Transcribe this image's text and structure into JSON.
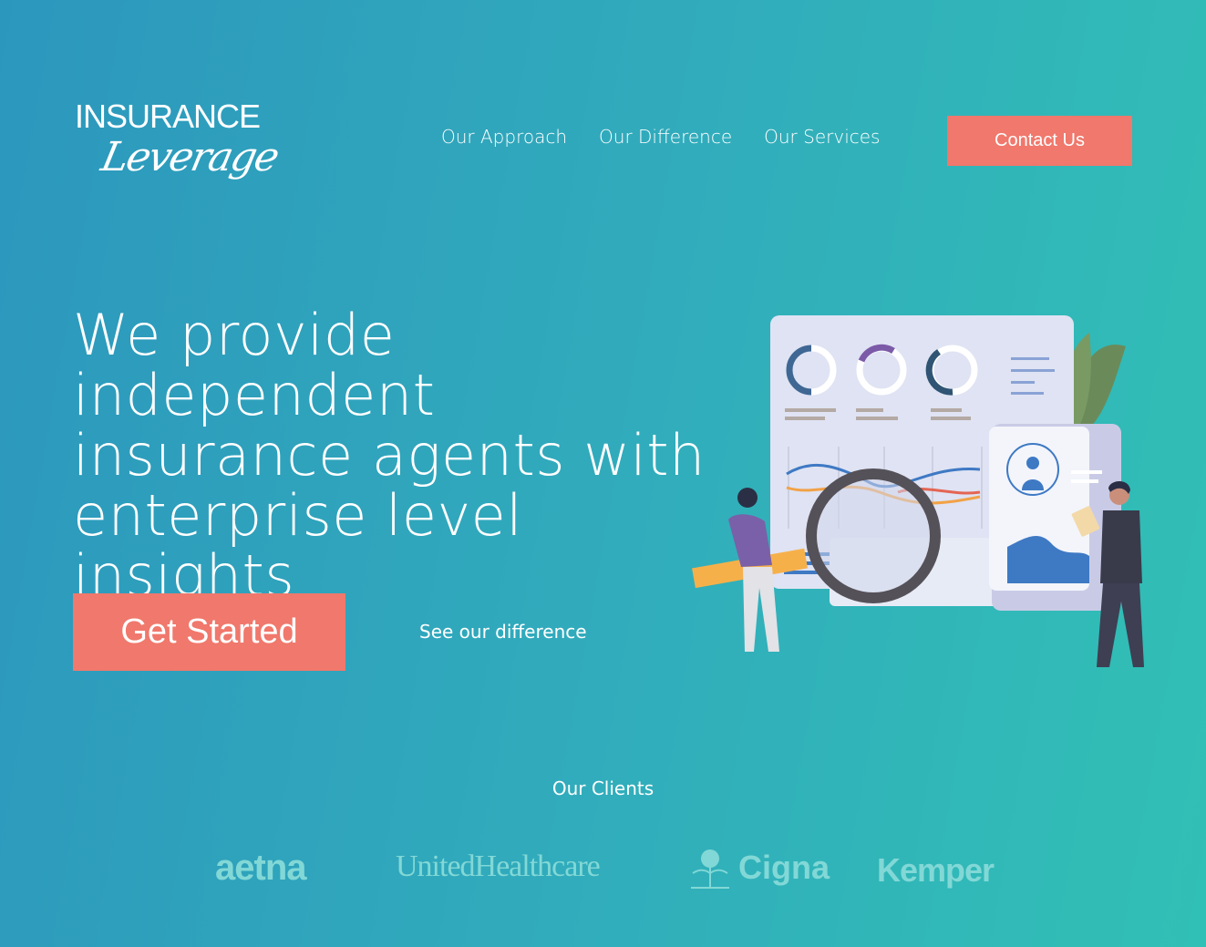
{
  "brand": {
    "name_top": "INSURANCE",
    "name_script": "Leverage"
  },
  "nav": {
    "items": [
      "Our Approach",
      "Our Difference",
      "Our Services"
    ],
    "contact": "Contact Us"
  },
  "hero": {
    "lines": [
      "We provide independent",
      "insurance agents with",
      "enterprise level insights"
    ],
    "cta": "Get Started",
    "secondary": "See our difference"
  },
  "clients": {
    "title": "Our Clients",
    "logos": [
      "aetna",
      "UnitedHealthcare",
      "Cigna",
      "Kemper"
    ]
  },
  "colors": {
    "accent": "#f0786c",
    "bg_start": "#2c97bd",
    "bg_end": "#31c0b5",
    "client_logo": "#82d8d6"
  }
}
